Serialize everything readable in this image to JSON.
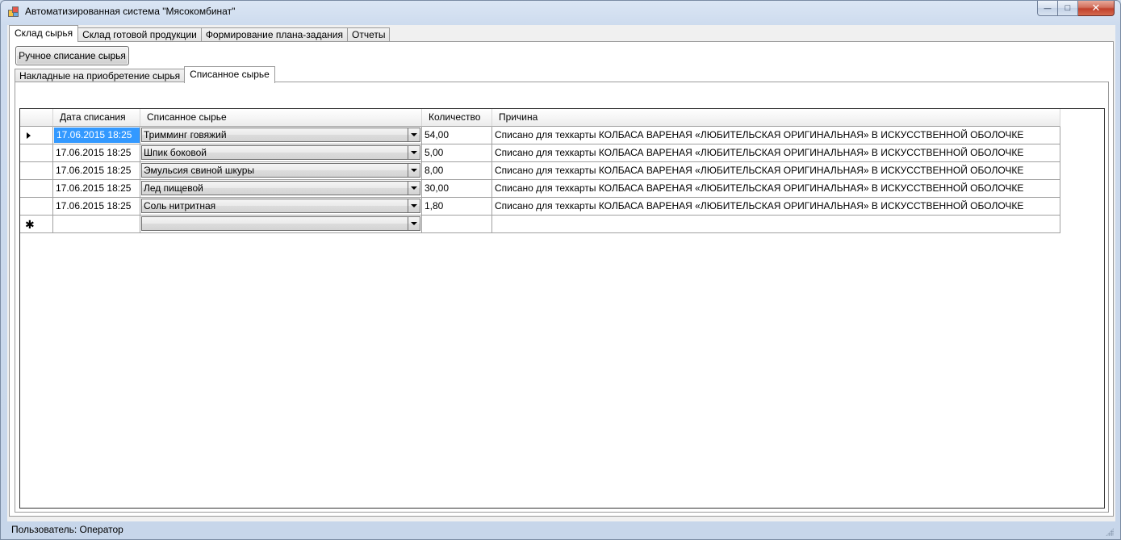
{
  "window": {
    "title": "Автоматизированная система \"Мясокомбинат\"",
    "controls": {
      "minimize": "—",
      "maximize": "□",
      "close": "✕"
    }
  },
  "main_tabs": [
    {
      "label": "Склад сырья",
      "active": true
    },
    {
      "label": "Склад готовой продукции",
      "active": false
    },
    {
      "label": "Формирование плана-задания",
      "active": false
    },
    {
      "label": "Отчеты",
      "active": false
    }
  ],
  "toolbar": {
    "manual_writeoff_label": "Ручное списание сырья"
  },
  "sub_tabs": [
    {
      "label": "Накладные на приобретение сырья",
      "active": false
    },
    {
      "label": "Списанное сырье",
      "active": true
    }
  ],
  "grid": {
    "columns": [
      "Дата списания",
      "Списанное сырье",
      "Количество",
      "Причина"
    ],
    "rows": [
      {
        "date": "17.06.2015 18:25",
        "material": "Тримминг говяжий",
        "qty": "54,00",
        "reason": "Списано для техкарты КОЛБАСА ВАРЕНАЯ «ЛЮБИТЕЛЬСКАЯ ОРИГИНАЛЬНАЯ» В ИСКУССТВЕННОЙ ОБОЛОЧКЕ"
      },
      {
        "date": "17.06.2015 18:25",
        "material": "Шпик боковой",
        "qty": "5,00",
        "reason": "Списано для техкарты КОЛБАСА ВАРЕНАЯ «ЛЮБИТЕЛЬСКАЯ ОРИГИНАЛЬНАЯ» В ИСКУССТВЕННОЙ ОБОЛОЧКЕ"
      },
      {
        "date": "17.06.2015 18:25",
        "material": "Эмульсия свиной шкуры",
        "qty": "8,00",
        "reason": "Списано для техкарты КОЛБАСА ВАРЕНАЯ «ЛЮБИТЕЛЬСКАЯ ОРИГИНАЛЬНАЯ» В ИСКУССТВЕННОЙ ОБОЛОЧКЕ"
      },
      {
        "date": "17.06.2015 18:25",
        "material": "Лед пищевой",
        "qty": "30,00",
        "reason": "Списано для техкарты КОЛБАСА ВАРЕНАЯ «ЛЮБИТЕЛЬСКАЯ ОРИГИНАЛЬНАЯ» В ИСКУССТВЕННОЙ ОБОЛОЧКЕ"
      },
      {
        "date": "17.06.2015 18:25",
        "material": "Соль нитритная",
        "qty": "1,80",
        "reason": "Списано для техкарты КОЛБАСА ВАРЕНАЯ «ЛЮБИТЕЛЬСКАЯ ОРИГИНАЛЬНАЯ» В ИСКУССТВЕННОЙ ОБОЛОЧКЕ"
      }
    ],
    "current_row_marker": "▶",
    "new_row_marker": "✱"
  },
  "status": {
    "user_text": "Пользователь: Оператор"
  }
}
